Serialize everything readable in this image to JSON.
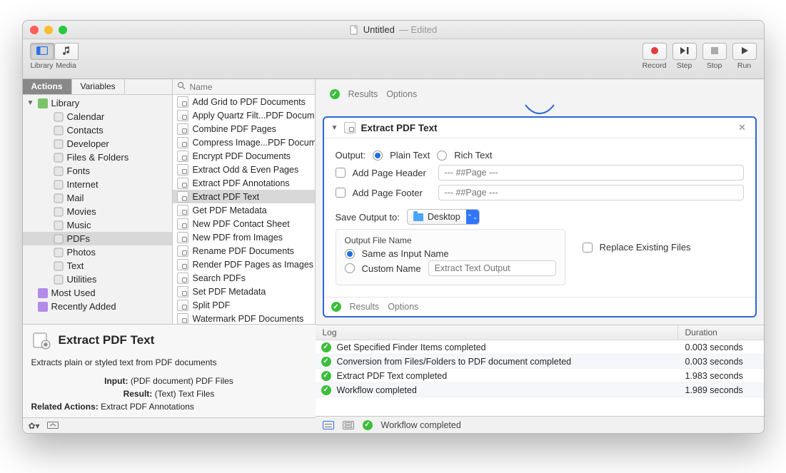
{
  "title": {
    "name": "Untitled",
    "suffix": "— Edited"
  },
  "toolbar": {
    "library": "Library",
    "media": "Media",
    "record": "Record",
    "step": "Step",
    "stop": "Stop",
    "run": "Run"
  },
  "left_tabs": {
    "actions": "Actions",
    "variables": "Variables"
  },
  "search_placeholder": "Name",
  "library_tree": [
    {
      "label": "Library",
      "color": "#7ac36b",
      "top": true
    },
    {
      "label": "Calendar"
    },
    {
      "label": "Contacts"
    },
    {
      "label": "Developer"
    },
    {
      "label": "Files & Folders"
    },
    {
      "label": "Fonts"
    },
    {
      "label": "Internet"
    },
    {
      "label": "Mail"
    },
    {
      "label": "Movies"
    },
    {
      "label": "Music"
    },
    {
      "label": "PDFs",
      "selected": true
    },
    {
      "label": "Photos"
    },
    {
      "label": "Text"
    },
    {
      "label": "Utilities"
    },
    {
      "label": "Most Used",
      "color": "#b48be8",
      "top": true,
      "noDisclosure": true
    },
    {
      "label": "Recently Added",
      "color": "#b48be8",
      "top": true,
      "noDisclosure": true
    }
  ],
  "actions": [
    "Add Grid to PDF Documents",
    "Apply Quartz Filt...PDF Documents",
    "Combine PDF Pages",
    "Compress Image...PDF Documents",
    "Encrypt PDF Documents",
    "Extract Odd & Even Pages",
    "Extract PDF Annotations",
    {
      "label": "Extract PDF Text",
      "selected": true
    },
    "Get PDF Metadata",
    "New PDF Contact Sheet",
    "New PDF from Images",
    "Rename PDF Documents",
    "Render PDF Pages as Images",
    "Search PDFs",
    "Set PDF Metadata",
    "Split PDF",
    "Watermark PDF Documents"
  ],
  "info": {
    "title": "Extract PDF Text",
    "desc": "Extracts plain or styled text from PDF documents",
    "input_k": "Input:",
    "input_v": "(PDF document) PDF Files",
    "result_k": "Result:",
    "result_v": "(Text) Text Files",
    "related_k": "Related Actions:",
    "related_v": "Extract PDF Annotations"
  },
  "card": {
    "title": "Extract PDF Text",
    "results": "Results",
    "options": "Options",
    "output_label": "Output:",
    "plain": "Plain Text",
    "rich": "Rich Text",
    "add_header": "Add Page Header",
    "header_ph": "--- ##Page ---",
    "add_footer": "Add Page Footer",
    "footer_ph": "--- ##Page ---",
    "save_to": "Save Output to:",
    "save_to_value": "Desktop",
    "ofn_title": "Output File Name",
    "same": "Same as Input Name",
    "custom": "Custom Name",
    "custom_ph": "Extract Text Output",
    "replace": "Replace Existing Files"
  },
  "log_head": {
    "msg": "Log",
    "dur": "Duration"
  },
  "log": [
    {
      "msg": "Get Specified Finder Items completed",
      "dur": "0.003 seconds"
    },
    {
      "msg": "Conversion from Files/Folders to PDF document completed",
      "dur": "0.003 seconds"
    },
    {
      "msg": "Extract PDF Text completed",
      "dur": "1.983 seconds"
    },
    {
      "msg": "Workflow completed",
      "dur": "1.989 seconds"
    }
  ],
  "status": "Workflow completed"
}
